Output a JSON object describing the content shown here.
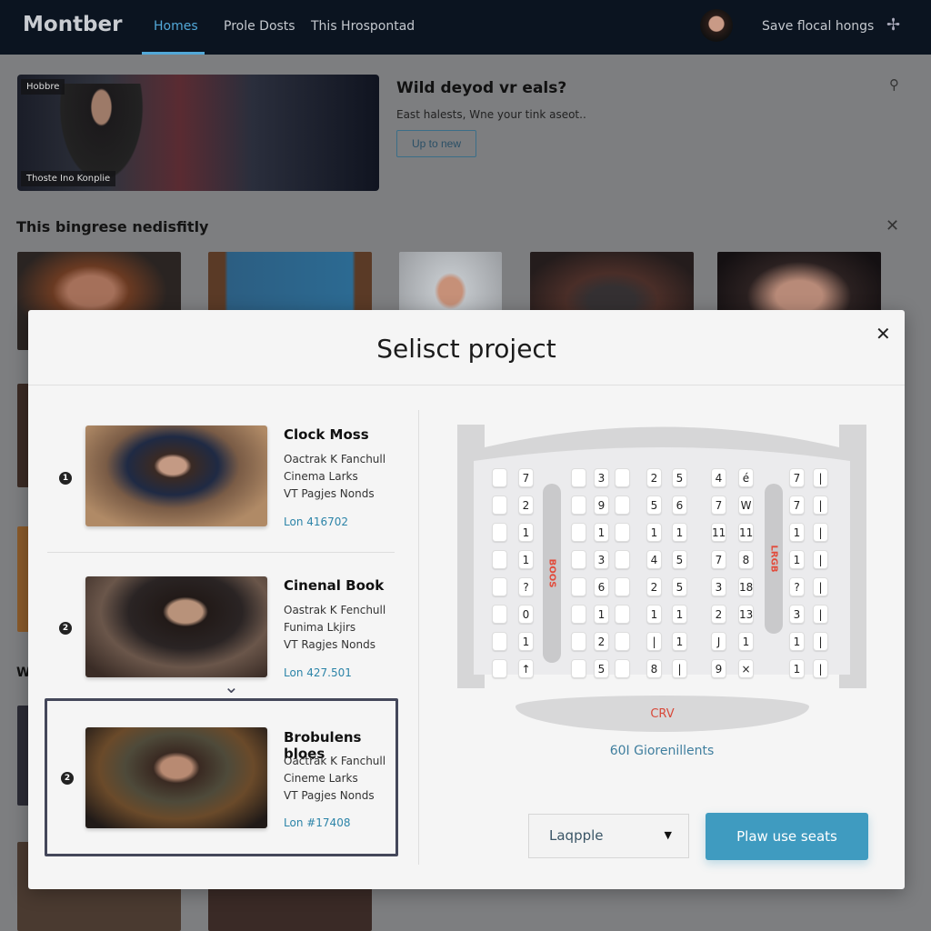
{
  "header": {
    "logo": "Montber",
    "nav": [
      "Homes",
      "Prole Dosts",
      "This Hrospontad"
    ],
    "active_nav": "Homes",
    "save_label": "Save flocal hongs",
    "menu_icon": "sparkle-icon"
  },
  "hero": {
    "tag_top": "Hobbre",
    "tag_bottom": "Thoste Ino Konplie",
    "title": "Wild deyod vr eals?",
    "subtitle": "East halests, Wne your tink aseot..",
    "button": "Up to new",
    "pin_icon": "pin-icon"
  },
  "section": {
    "title": "This bingrese nedisfitly",
    "partial_label": "W"
  },
  "modal": {
    "title": "Selisct project",
    "items": [
      {
        "num": "1",
        "title": "Clock Moss",
        "lines": [
          "Oactrak K Fanchull",
          "Cinema Larks",
          "VT Pagjes Nonds"
        ],
        "lon": "Lon 416702"
      },
      {
        "num": "2",
        "title": "Cinenal Book",
        "lines": [
          "Oastrak K Fenchull",
          "Funima Lkjirs",
          "VT Ragjes Nonds"
        ],
        "lon": "Lon 427.501"
      },
      {
        "num": "2",
        "title": "Brobulens bloes",
        "lines": [
          "Oactrak K Fanchull",
          "Cineme Larks",
          "VT Pagjes Nonds"
        ],
        "lon": "Lon #17408",
        "selected": true
      }
    ],
    "seat_map": {
      "aisle_left": "BOOS",
      "aisle_right": "LRGB",
      "rows": [
        [
          "",
          "7",
          "",
          "3",
          "",
          "2",
          "5",
          "4",
          "é",
          "7",
          "|"
        ],
        [
          "",
          "2",
          "",
          "9",
          "",
          "5",
          "6",
          "7",
          "W",
          "7",
          "|"
        ],
        [
          "",
          "1",
          "",
          "1",
          "",
          "1",
          "1",
          "11",
          "11",
          "1",
          "|"
        ],
        [
          "",
          "1",
          "",
          "3",
          "",
          "4",
          "5",
          "7",
          "8",
          "1",
          "|"
        ],
        [
          "",
          "?",
          "",
          "6",
          "",
          "2",
          "5",
          "3",
          "18",
          "?",
          "|"
        ],
        [
          "",
          "0",
          "",
          "1",
          "",
          "1",
          "1",
          "2",
          "13",
          "3",
          "|"
        ],
        [
          "",
          "1",
          "",
          "2",
          "",
          "|",
          "1",
          "J",
          "1",
          "1",
          "|"
        ],
        [
          "",
          "↑",
          "",
          "5",
          "",
          "8",
          "|",
          "9",
          "×",
          "1",
          "|"
        ]
      ],
      "stage": "CRV",
      "count": "60I Giorenillents"
    },
    "dropdown": "Laqpple",
    "primary_button": "Plaw use seats"
  }
}
